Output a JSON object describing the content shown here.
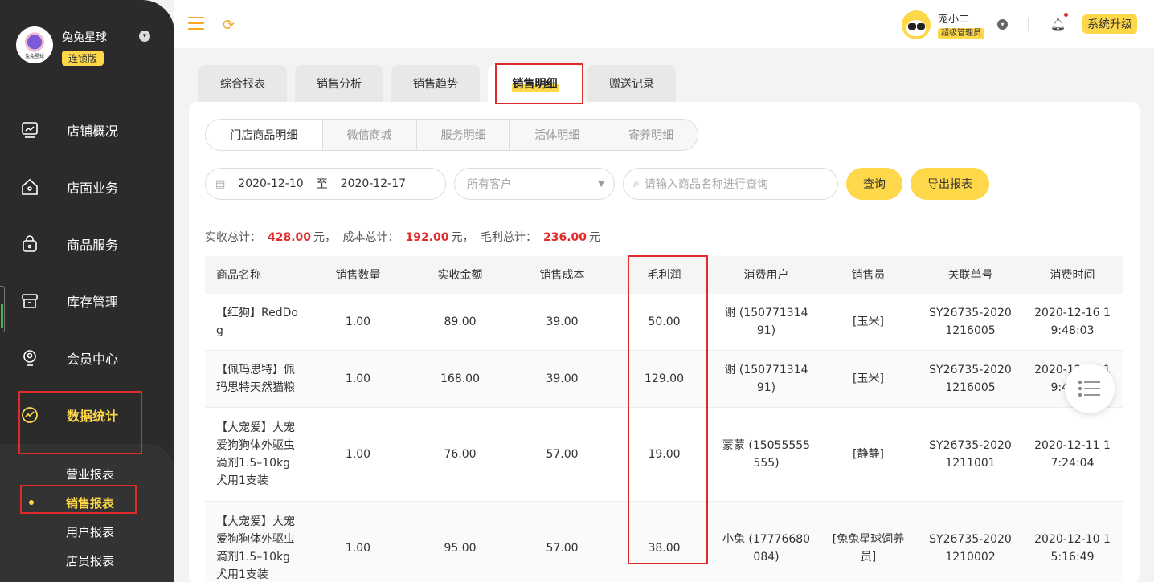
{
  "brand": {
    "name": "兔兔星球",
    "badge": "连锁版",
    "logo_text": "兔兔星球"
  },
  "sidebar": {
    "items": [
      {
        "label": "店铺概况",
        "icon": "monitor-icon"
      },
      {
        "label": "店面业务",
        "icon": "home-icon"
      },
      {
        "label": "商品服务",
        "icon": "bag-icon"
      },
      {
        "label": "库存管理",
        "icon": "box-icon"
      },
      {
        "label": "会员中心",
        "icon": "member-icon"
      },
      {
        "label": "数据统计",
        "icon": "chart-icon"
      }
    ],
    "subitems": [
      "营业报表",
      "销售报表",
      "用户报表",
      "店员报表"
    ]
  },
  "topbar": {
    "user_name": "宠小二",
    "user_role": "超级管理员",
    "upgrade": "系统升级"
  },
  "tabs": [
    "综合报表",
    "销售分析",
    "销售趋势",
    "销售明细",
    "赠送记录"
  ],
  "subtabs": [
    "门店商品明细",
    "微信商城",
    "服务明细",
    "活体明细",
    "寄养明细"
  ],
  "filters": {
    "date_start": "2020-12-10",
    "date_sep": "至",
    "date_end": "2020-12-17",
    "customer_placeholder": "所有客户",
    "search_placeholder": "请输入商品名称进行查询",
    "query_button": "查询",
    "export_button": "导出报表"
  },
  "summary": {
    "received_label": "实收总计：",
    "received": "428.00",
    "cost_label": "成本总计：",
    "cost": "192.00",
    "profit_label": "毛利总计：",
    "profit": "236.00",
    "unit": "元",
    "sep": "，"
  },
  "table": {
    "headers": [
      "商品名称",
      "销售数量",
      "实收金额",
      "销售成本",
      "毛利润",
      "消费用户",
      "销售员",
      "关联单号",
      "消费时间"
    ],
    "rows": [
      [
        "【红狗】RedDo\ng",
        "1.00",
        "89.00",
        "39.00",
        "50.00",
        "谢 (150771314\n91)",
        "[玉米]",
        "SY26735-2020\n1216005",
        "2020-12-16 1\n9:48:03"
      ],
      [
        "【佩玛思特】佩\n玛思特天然猫粮",
        "1.00",
        "168.00",
        "39.00",
        "129.00",
        "谢 (150771314\n91)",
        "[玉米]",
        "SY26735-2020\n1216005",
        "2020-12-16 1\n9:48:03"
      ],
      [
        "【大宠爱】大宠\n爱狗狗体外驱虫\n滴剂1.5–10kg\n犬用1支装",
        "1.00",
        "76.00",
        "57.00",
        "19.00",
        "蒙蒙 (15055555\n555)",
        "[静静]",
        "SY26735-2020\n1211001",
        "2020-12-11 1\n7:24:04"
      ],
      [
        "【大宠爱】大宠\n爱狗狗体外驱虫\n滴剂1.5–10kg\n犬用1支装",
        "1.00",
        "95.00",
        "57.00",
        "38.00",
        "小兔 (17776680\n084)",
        "[兔兔星球饲养\n员]",
        "SY26735-2020\n1210002",
        "2020-12-10 1\n5:16:49"
      ]
    ]
  },
  "colors": {
    "accent": "#ffd84a",
    "sidebar": "#2b2b2b",
    "highlight": "#e12b2b"
  }
}
